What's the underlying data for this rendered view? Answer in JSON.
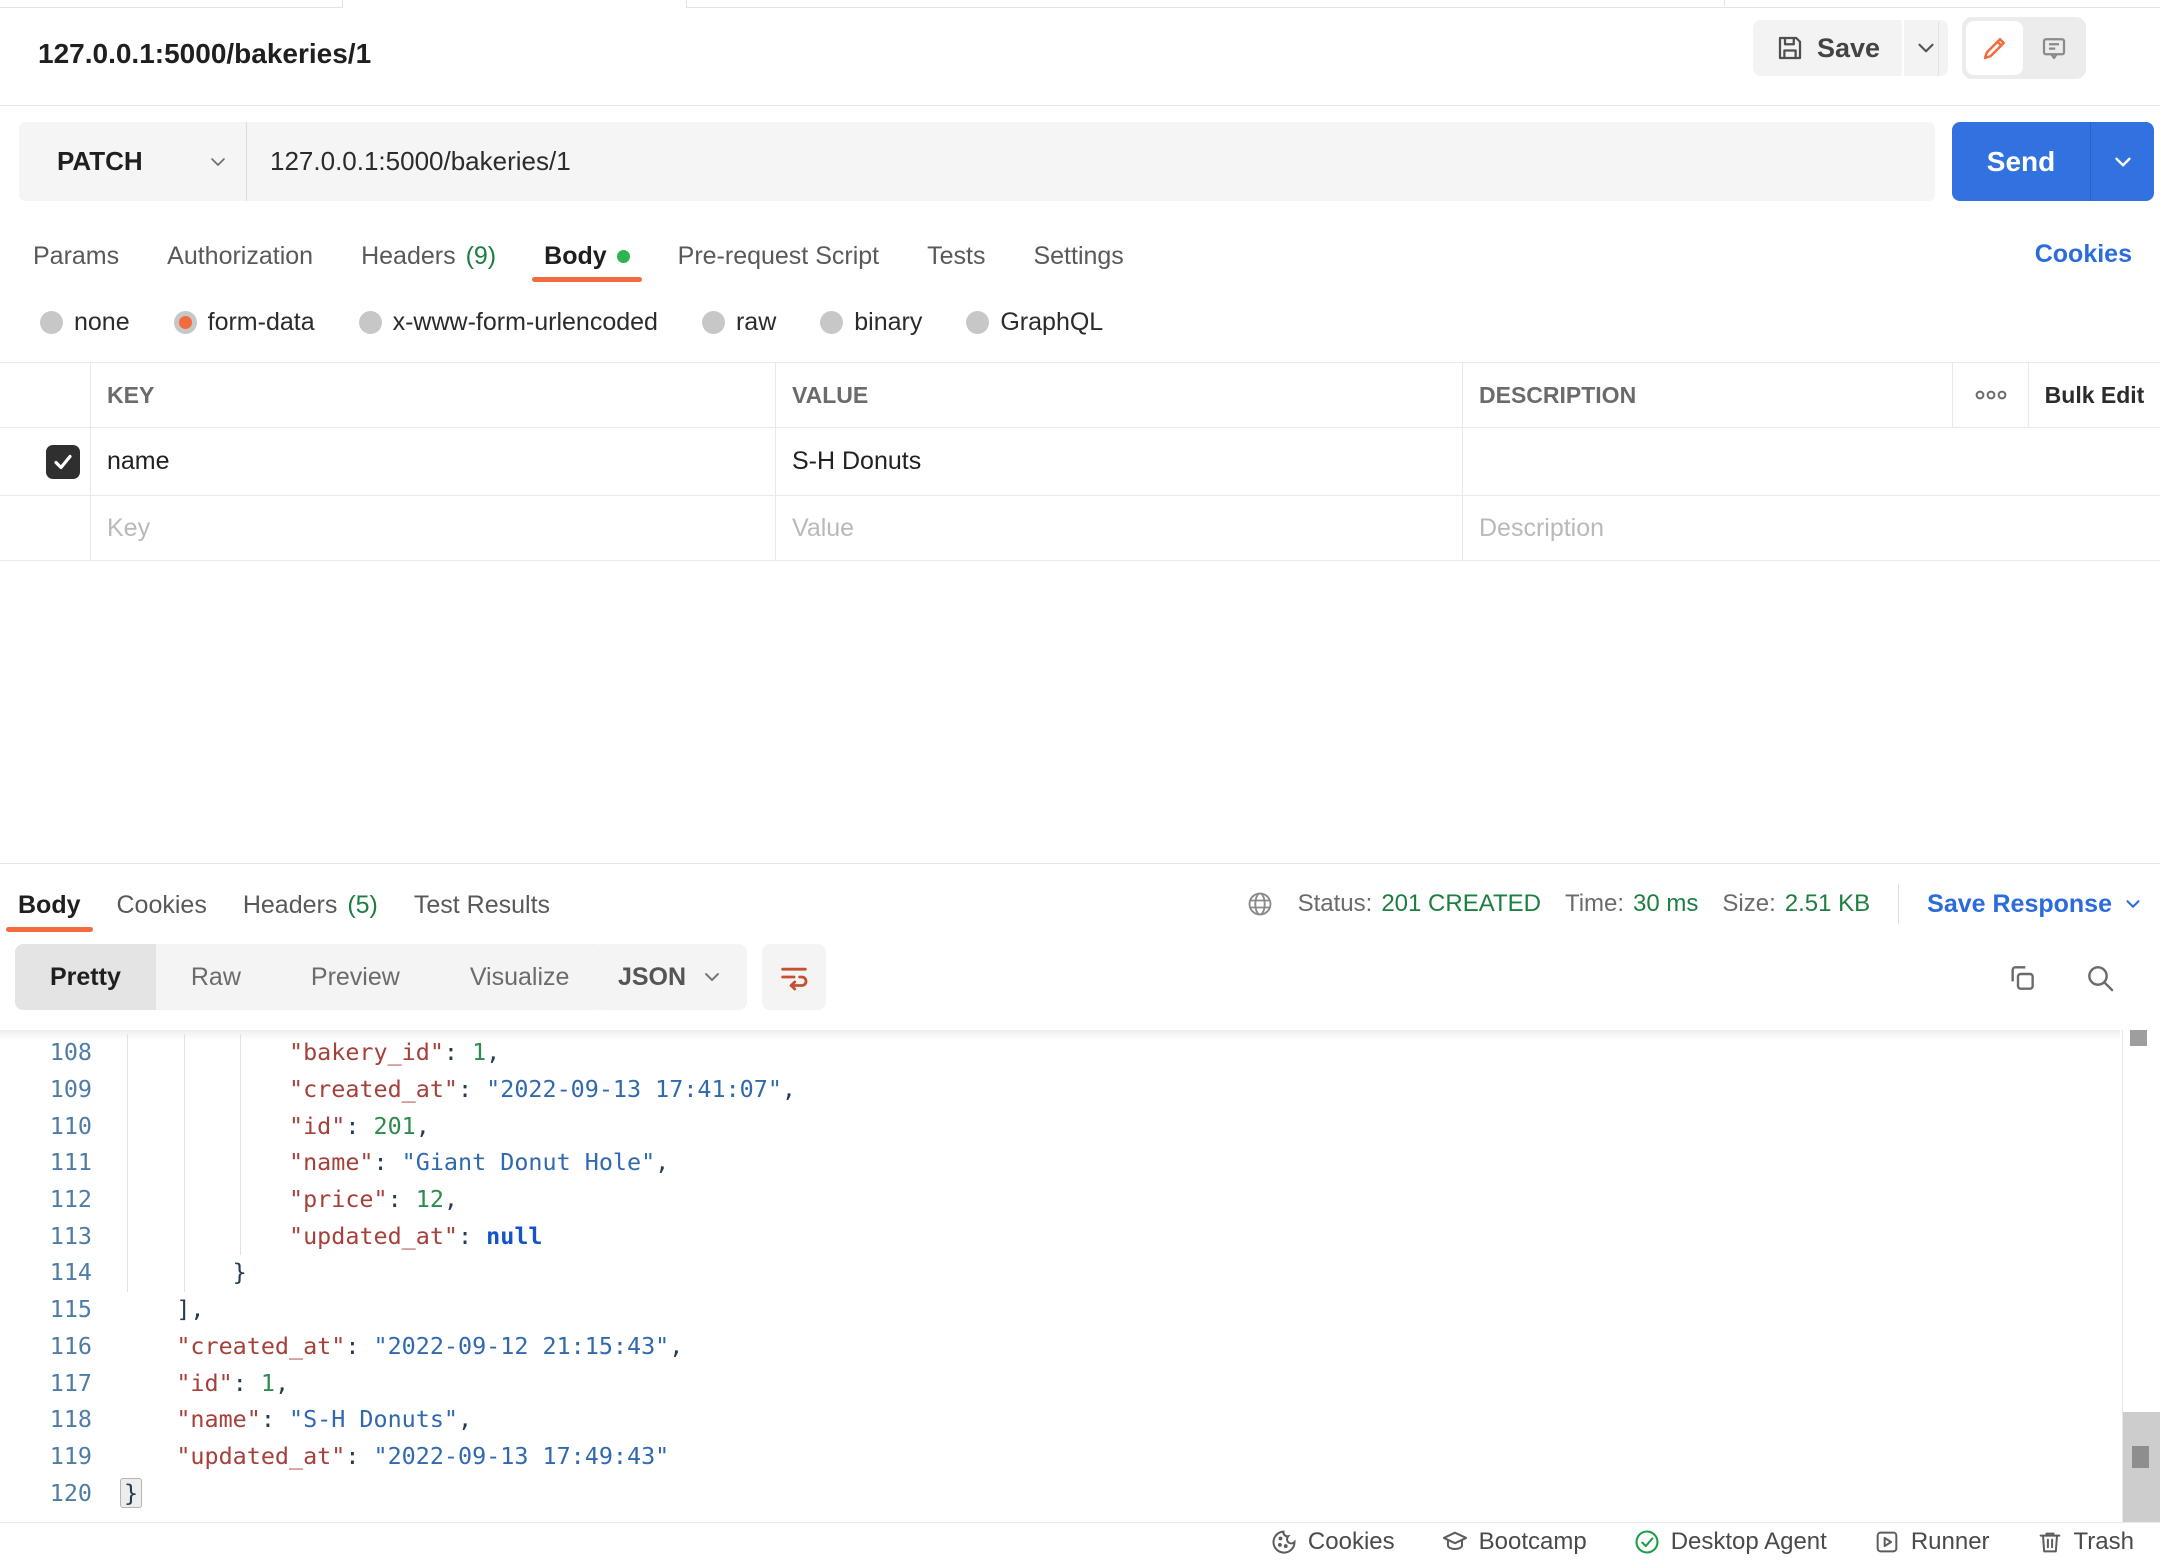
{
  "header": {
    "title": "127.0.0.1:5000/bakeries/1",
    "save_label": "Save"
  },
  "request": {
    "method": "PATCH",
    "url": "127.0.0.1:5000/bakeries/1",
    "send_label": "Send",
    "cookies_link": "Cookies",
    "tabs": [
      {
        "label": "Params"
      },
      {
        "label": "Authorization"
      },
      {
        "label": "Headers",
        "count": "(9)"
      },
      {
        "label": "Body",
        "active": true
      },
      {
        "label": "Pre-request Script"
      },
      {
        "label": "Tests"
      },
      {
        "label": "Settings"
      }
    ],
    "body_modes": [
      {
        "label": "none"
      },
      {
        "label": "form-data",
        "selected": true
      },
      {
        "label": "x-www-form-urlencoded"
      },
      {
        "label": "raw"
      },
      {
        "label": "binary"
      },
      {
        "label": "GraphQL"
      }
    ],
    "table": {
      "col_key": "KEY",
      "col_value": "VALUE",
      "col_description": "DESCRIPTION",
      "bulk_edit": "Bulk Edit",
      "row": {
        "checked": true,
        "key": "name",
        "value": "S-H Donuts",
        "description": ""
      },
      "placeholders": {
        "key": "Key",
        "value": "Value",
        "description": "Description"
      }
    }
  },
  "response": {
    "tabs": [
      {
        "label": "Body",
        "active": true
      },
      {
        "label": "Cookies"
      },
      {
        "label": "Headers",
        "count": "(5)"
      },
      {
        "label": "Test Results"
      }
    ],
    "meta": {
      "status_label": "Status:",
      "status_value": "201 CREATED",
      "time_label": "Time:",
      "time_value": "30 ms",
      "size_label": "Size:",
      "size_value": "2.51 KB",
      "save_response": "Save Response"
    },
    "view_modes": [
      {
        "label": "Pretty",
        "active": true
      },
      {
        "label": "Raw"
      },
      {
        "label": "Preview"
      },
      {
        "label": "Visualize"
      }
    ],
    "format": "JSON",
    "code_lines": [
      {
        "num": 108,
        "indent": 3,
        "tokens": [
          [
            "key",
            "\"bakery_id\""
          ],
          [
            "punct",
            ": "
          ],
          [
            "num",
            "1"
          ],
          [
            "punct",
            ","
          ]
        ]
      },
      {
        "num": 109,
        "indent": 3,
        "tokens": [
          [
            "key",
            "\"created_at\""
          ],
          [
            "punct",
            ": "
          ],
          [
            "str",
            "\"2022-09-13 17:41:07\""
          ],
          [
            "punct",
            ","
          ]
        ]
      },
      {
        "num": 110,
        "indent": 3,
        "tokens": [
          [
            "key",
            "\"id\""
          ],
          [
            "punct",
            ": "
          ],
          [
            "num",
            "201"
          ],
          [
            "punct",
            ","
          ]
        ]
      },
      {
        "num": 111,
        "indent": 3,
        "tokens": [
          [
            "key",
            "\"name\""
          ],
          [
            "punct",
            ": "
          ],
          [
            "str",
            "\"Giant Donut Hole\""
          ],
          [
            "punct",
            ","
          ]
        ]
      },
      {
        "num": 112,
        "indent": 3,
        "tokens": [
          [
            "key",
            "\"price\""
          ],
          [
            "punct",
            ": "
          ],
          [
            "num",
            "12"
          ],
          [
            "punct",
            ","
          ]
        ]
      },
      {
        "num": 113,
        "indent": 3,
        "tokens": [
          [
            "key",
            "\"updated_at\""
          ],
          [
            "punct",
            ": "
          ],
          [
            "null",
            "null"
          ]
        ]
      },
      {
        "num": 114,
        "indent": 2,
        "tokens": [
          [
            "punct",
            "}"
          ]
        ]
      },
      {
        "num": 115,
        "indent": 1,
        "tokens": [
          [
            "punct",
            "],"
          ]
        ]
      },
      {
        "num": 116,
        "indent": 1,
        "tokens": [
          [
            "key",
            "\"created_at\""
          ],
          [
            "punct",
            ": "
          ],
          [
            "str",
            "\"2022-09-12 21:15:43\""
          ],
          [
            "punct",
            ","
          ]
        ]
      },
      {
        "num": 117,
        "indent": 1,
        "tokens": [
          [
            "key",
            "\"id\""
          ],
          [
            "punct",
            ": "
          ],
          [
            "num",
            "1"
          ],
          [
            "punct",
            ","
          ]
        ]
      },
      {
        "num": 118,
        "indent": 1,
        "tokens": [
          [
            "key",
            "\"name\""
          ],
          [
            "punct",
            ": "
          ],
          [
            "str",
            "\"S-H Donuts\""
          ],
          [
            "punct",
            ","
          ]
        ]
      },
      {
        "num": 119,
        "indent": 1,
        "tokens": [
          [
            "key",
            "\"updated_at\""
          ],
          [
            "punct",
            ": "
          ],
          [
            "str",
            "\"2022-09-13 17:49:43\""
          ]
        ]
      },
      {
        "num": 120,
        "indent": 0,
        "tokens": [
          [
            "brace-hl",
            "}"
          ]
        ]
      }
    ]
  },
  "footer": {
    "items": [
      {
        "label": "Cookies"
      },
      {
        "label": "Bootcamp"
      },
      {
        "label": "Desktop Agent"
      },
      {
        "label": "Runner"
      },
      {
        "label": "Trash"
      }
    ]
  },
  "colors": {
    "accent_orange": "#f26b3d",
    "send_blue": "#3172e0",
    "link_blue": "#2b6bdb",
    "status_green": "#1d7f3f"
  }
}
